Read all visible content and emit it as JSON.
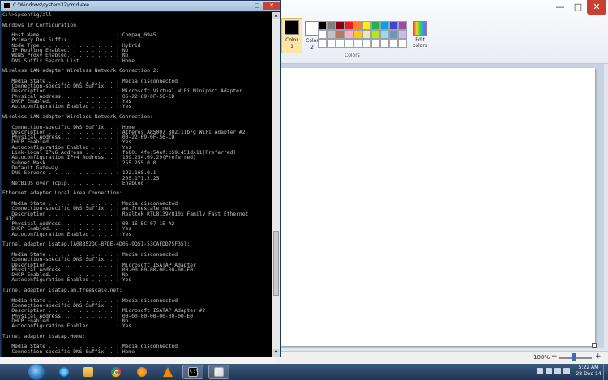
{
  "cmd": {
    "title": "C:\\Windows\\system32\\cmd.exe",
    "minimize": "—",
    "maximize": "□",
    "close": "✕",
    "lines": [
      "C:\\>ipconfig/all",
      "",
      "Windows IP Configuration",
      "",
      "   Host Name . . . . . . . . . . . . : Compaq_0945",
      "   Primary Dns Suffix  . . . . . . . :",
      "   Node Type . . . . . . . . . . . . : Hybrid",
      "   IP Routing Enabled. . . . . . . . : No",
      "   WINS Proxy Enabled. . . . . . . . : No",
      "   DNS Suffix Search List. . . . . . : Home",
      "",
      "Wireless LAN adapter Wireless Network Connection 2:",
      "",
      "   Media State . . . . . . . . . . . : Media disconnected",
      "   Connection-specific DNS Suffix  . :",
      "   Description . . . . . . . . . . . : Microsoft Virtual WiFi Miniport Adapter",
      "   Physical Address. . . . . . . . . : 06-22-69-0F-56-CD",
      "   DHCP Enabled. . . . . . . . . . . : Yes",
      "   Autoconfiguration Enabled . . . . : Yes",
      "",
      "Wireless LAN adapter Wireless Network Connection:",
      "",
      "   Connection-specific DNS Suffix  . : Home",
      "   Description . . . . . . . . . . . : Atheros AR5007 802.11b/g WiFi Adapter #2",
      "   Physical Address. . . . . . . . . : 00-22-69-0F-56-CD",
      "   DHCP Enabled. . . . . . . . . . . : Yes",
      "   Autoconfiguration Enabled . . . . : Yes",
      "   Link-local IPv6 Address . . . . . : fe80::4fe:54af:c59:451dx11(Preferred)",
      "   Autoconfiguration IPv4 Address. . : 169.254.69.29(Preferred)",
      "   Subnet Mask . . . . . . . . . . . : 255.255.0.0",
      "   Default Gateway . . . . . . . . . :",
      "   DNS Servers . . . . . . . . . . . : 192.168.0.1",
      "                                       205.171.2.25",
      "   NetBIOS over Tcpip. . . . . . . . : Enabled",
      "",
      "Ethernet adapter Local Area Connection:",
      "",
      "   Media State . . . . . . . . . . . : Media disconnected",
      "   Connection-specific DNS Suffix  . : am.freescale.net",
      "   Description . . . . . . . . . . . : Realtek RTL8139/810x Family Fast Ethernet",
      " NIC",
      "   Physical Address. . . . . . . . . : 00-1E-EC-07-15-A2",
      "   DHCP Enabled. . . . . . . . . . . : Yes",
      "   Autoconfiguration Enabled . . . . : Yes",
      "",
      "Tunnel adapter isatap.{A08852DC-B7DE-4D05-9D51-53CAFDD75F35}:",
      "",
      "   Media State . . . . . . . . . . . : Media disconnected",
      "   Connection-specific DNS Suffix  . :",
      "   Description . . . . . . . . . . . : Microsoft ISATAP Adapter",
      "   Physical Address. . . . . . . . . : 00-00-00-00-00-00-00-E0",
      "   DHCP Enabled. . . . . . . . . . . : No",
      "   Autoconfiguration Enabled . . . . : Yes",
      "",
      "Tunnel adapter isatap.am.freescale.net:",
      "",
      "   Media State . . . . . . . . . . . : Media disconnected",
      "   Connection-specific DNS Suffix  . :",
      "   Description . . . . . . . . . . . : Microsoft ISATAP Adapter #2",
      "   Physical Address. . . . . . . . . : 00-00-00-00-00-00-00-E0",
      "   DHCP Enabled. . . . . . . . . . . : No",
      "   Autoconfiguration Enabled . . . . : Yes",
      "",
      "Tunnel adapter isatap.Home:",
      "",
      "   Media State . . . . . . . . . . . : Media disconnected",
      "   Connection-specific DNS Suffix  . : Home"
    ]
  },
  "paint": {
    "color1_label": "Color\n1",
    "color2_label": "Color\n2",
    "edit_colors_label": "Edit\ncolors",
    "group_label": "Colors",
    "minimize": "—",
    "maximize": "□",
    "close": "✕",
    "zoom": "100%",
    "zoom_minus": "−",
    "zoom_plus": "+",
    "palette": [
      "#000000",
      "#7f7f7f",
      "#880015",
      "#ed1c24",
      "#ff7f27",
      "#fff200",
      "#22b14c",
      "#00a2e8",
      "#3f48cc",
      "#a349a4",
      "#ffffff",
      "#c3c3c3",
      "#b97a57",
      "#ffaec9",
      "#ffc90e",
      "#efe4b0",
      "#b5e61d",
      "#99d9ea",
      "#7092be",
      "#c8bfe7",
      "#ffffff",
      "#ffffff",
      "#ffffff",
      "#ffffff",
      "#ffffff",
      "#ffffff",
      "#ffffff",
      "#ffffff",
      "#ffffff",
      "#ffffff"
    ],
    "color1": "#000000",
    "color2": "#ffffff"
  },
  "taskbar": {
    "cmd_glyph": "C:\\",
    "time": "5:22 AM",
    "date": "28-Dec-14"
  }
}
